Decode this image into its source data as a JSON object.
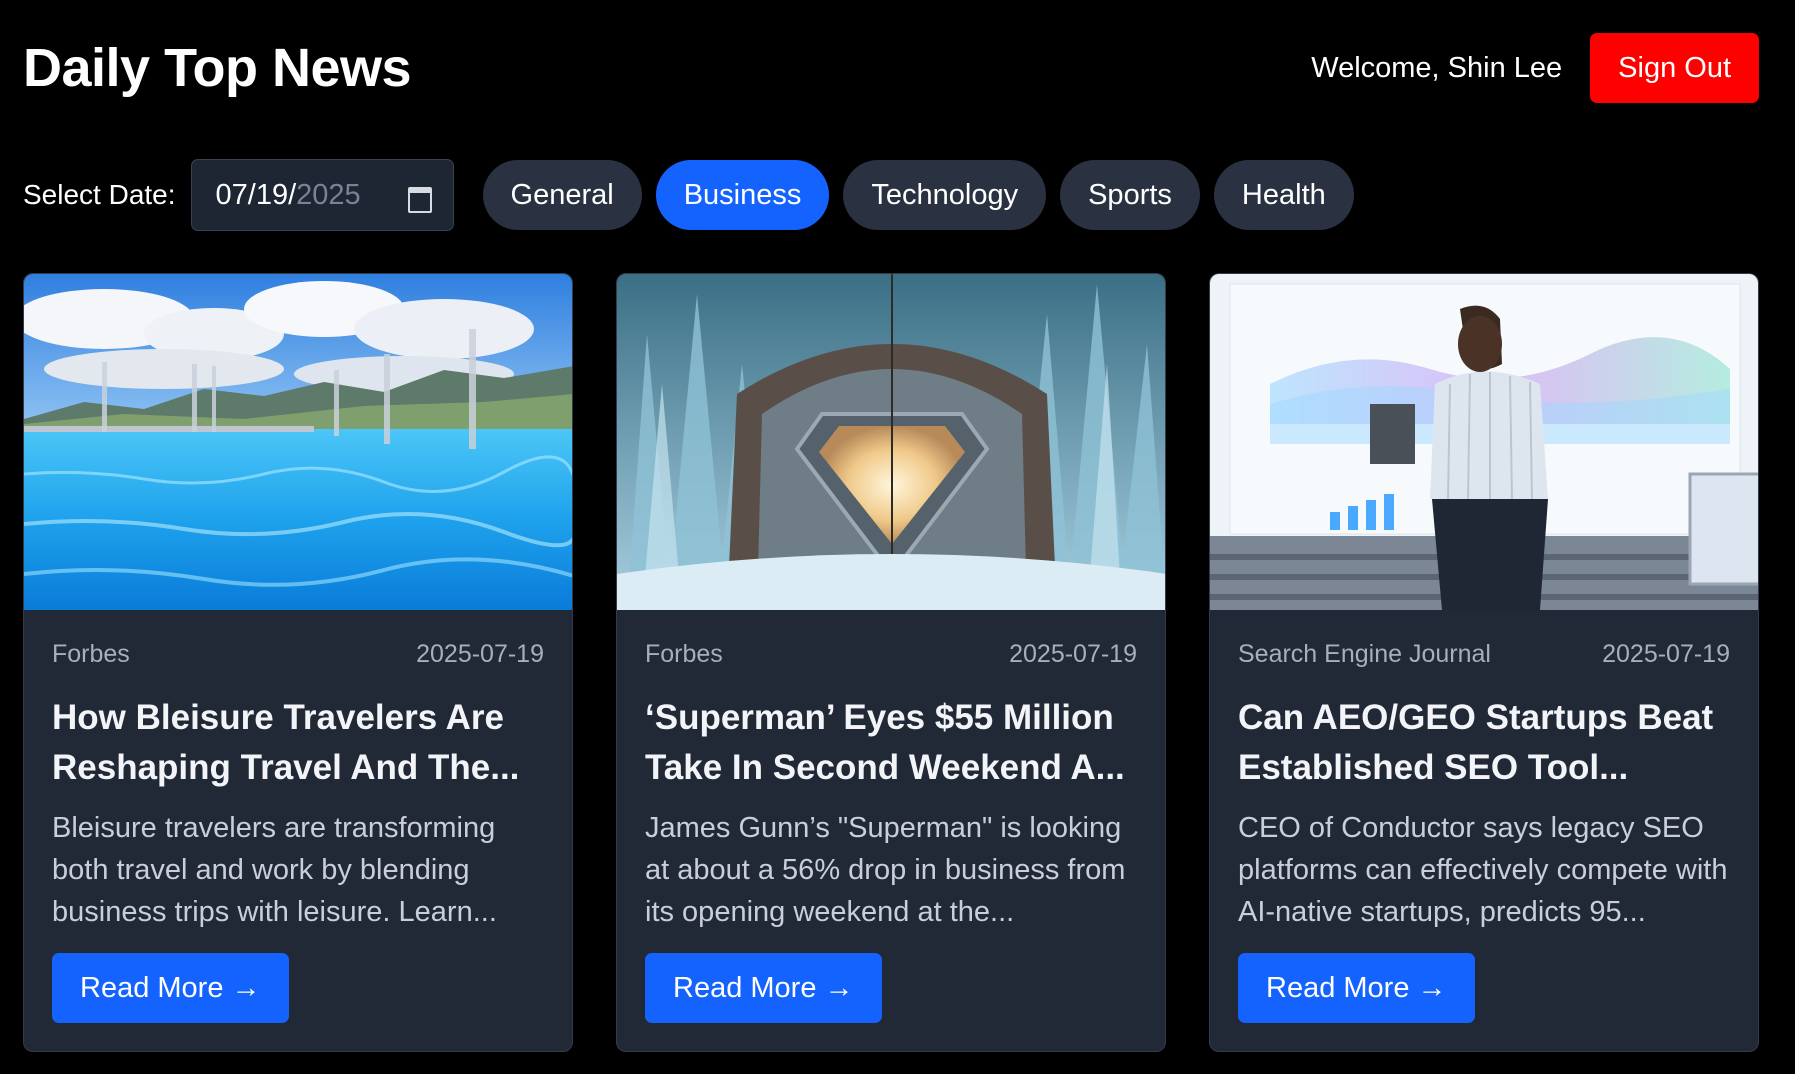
{
  "header": {
    "title": "Daily Top News",
    "welcome": "Welcome, Shin Lee",
    "sign_out": "Sign Out"
  },
  "filters": {
    "select_label": "Select Date:",
    "date_main": "07/19/",
    "date_year": "2025",
    "categories": [
      {
        "label": "General",
        "active": false
      },
      {
        "label": "Business",
        "active": true
      },
      {
        "label": "Technology",
        "active": false
      },
      {
        "label": "Sports",
        "active": false
      },
      {
        "label": "Health",
        "active": false
      }
    ]
  },
  "articles": [
    {
      "source": "Forbes",
      "date": "2025-07-19",
      "title": "How Bleisure Travelers Are Reshaping Travel And The...",
      "description": "Bleisure travelers are transforming both travel and work by blending business trips with leisure. Learn...",
      "read_more": "Read More →",
      "image": "infinity-pool-mountains"
    },
    {
      "source": "Forbes",
      "date": "2025-07-19",
      "title": "‘Superman’ Eyes $55 Million Take In Second Weekend A...",
      "description": "James Gunn’s \"Superman\" is looking at about a 56% drop in business from its opening weekend at the...",
      "read_more": "Read More →",
      "image": "ice-crystal-fortress"
    },
    {
      "source": "Search Engine Journal",
      "date": "2025-07-19",
      "title": "Can AEO/GEO Startups Beat Established SEO Tool...",
      "description": "CEO of Conductor says legacy SEO platforms can effectively compete with AI-native startups, predicts 95...",
      "read_more": "Read More →",
      "image": "woman-analytics-screen"
    }
  ],
  "colors": {
    "background": "#000000",
    "card": "#212836",
    "accent": "#1463ff",
    "danger": "#ff0000",
    "pill": "#2a3140"
  }
}
